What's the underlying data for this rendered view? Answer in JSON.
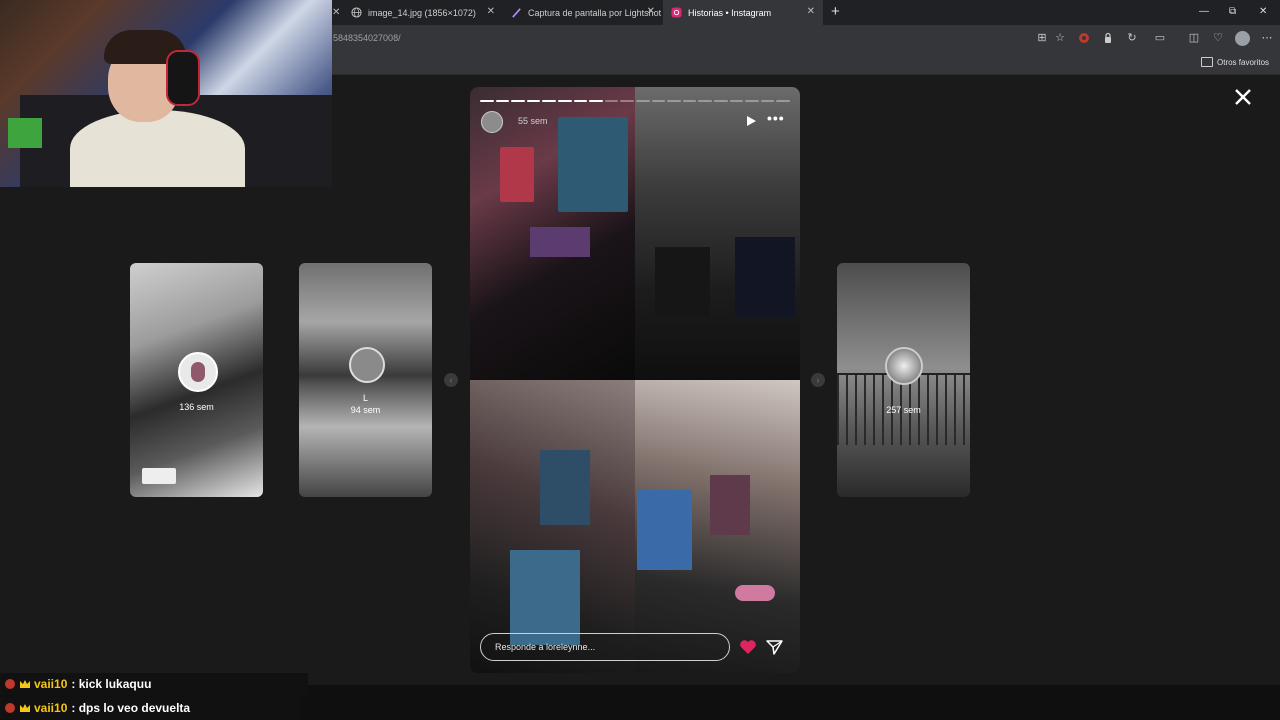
{
  "browser": {
    "tabs": [
      {
        "title": "image_14.jpg (1856×1072)",
        "active": false
      },
      {
        "title": "Captura de pantalla por Lightshot",
        "active": false
      },
      {
        "title": "Historias • Instagram",
        "active": true
      }
    ],
    "url_fragment": "5848354027008/",
    "bookmarks_folder": "Otros favoritos"
  },
  "stories": {
    "left_far": {
      "time": "136 sem"
    },
    "left_near": {
      "name": "L",
      "time": "94 sem"
    },
    "right": {
      "time": "257 sem"
    },
    "active": {
      "time": "55 sem",
      "segments_total": 20,
      "segments_done": 8,
      "reply_placeholder": "Responde a loreleynne..."
    }
  },
  "chat": [
    {
      "user": "vaii10",
      "message": ": kick lukaquu"
    },
    {
      "user": "vaii10",
      "message": ": dps lo veo devuelta"
    }
  ],
  "colors": {
    "accent_heart": "#e0245e",
    "chat_user": "#f5c518",
    "instagram_tab": "#d62976"
  }
}
